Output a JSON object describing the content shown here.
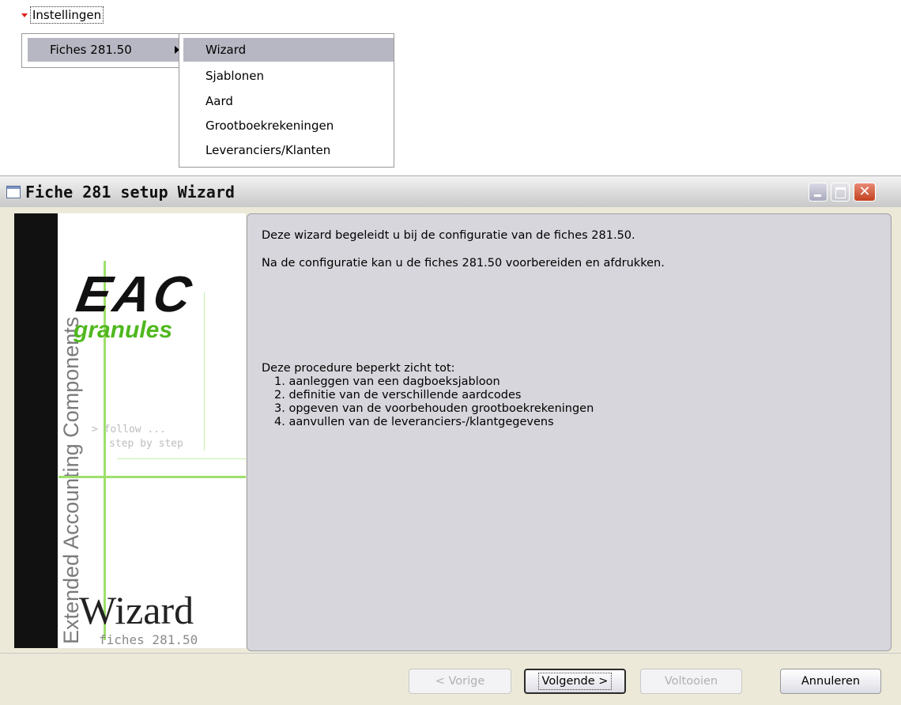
{
  "menu": {
    "root_label": "Instellingen",
    "sub1_label": "Fiches 281.50",
    "sub2_items": [
      "Wizard",
      "Sjablonen",
      "Aard",
      "Grootboekrekeningen",
      "Leveranciers/Klanten"
    ]
  },
  "window": {
    "title": "Fiche 281 setup Wizard",
    "close_glyph": "✕"
  },
  "sidepanel": {
    "vertical_text": "Extended Accounting Components",
    "logo_main": "EAC",
    "logo_sub": "granules",
    "follow_line1": "> follow ...",
    "follow_line2": "step by step",
    "wizard_word": "Wizard",
    "fiches_label": "fiches 281.50"
  },
  "content": {
    "p1": "Deze wizard begeleidt u bij de configuratie van de fiches 281.50.",
    "p2": "Na de configuratie kan u de fiches 281.50 voorbereiden en afdrukken.",
    "p3": "Deze procedure beperkt zicht tot:",
    "steps": [
      "1. aanleggen van een dagboeksjabloon",
      "2. definitie van de verschillende aardcodes",
      "3. opgeven van de voorbehouden grootboekrekeningen",
      "4. aanvullen van de leveranciers-/klantgegevens"
    ]
  },
  "buttons": {
    "back": "< Vorige",
    "next": "Volgende >",
    "finish": "Voltooien",
    "cancel": "Annuleren"
  }
}
